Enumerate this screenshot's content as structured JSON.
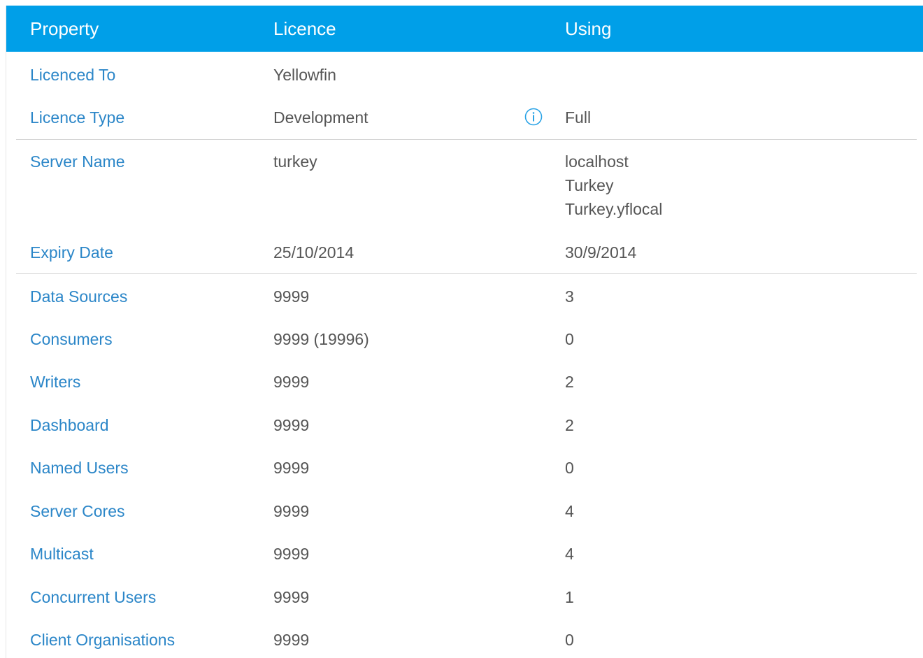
{
  "header": {
    "property": "Property",
    "licence": "Licence",
    "using": "Using"
  },
  "rows": [
    {
      "property": "Licenced To",
      "licence": "Yellowfin",
      "using": ""
    },
    {
      "property": "Licence Type",
      "licence": "Development",
      "using": "Full",
      "info_icon": "info-icon"
    },
    {
      "property": "Server Name",
      "licence": "turkey",
      "using": "localhost\nTurkey\nTurkey.yflocal"
    },
    {
      "property": "Expiry Date",
      "licence": "25/10/2014",
      "using": "30/9/2014"
    },
    {
      "property": "Data Sources",
      "licence": "9999",
      "using": "3"
    },
    {
      "property": "Consumers",
      "licence": "9999 (19996)",
      "using": "0"
    },
    {
      "property": "Writers",
      "licence": "9999",
      "using": "2"
    },
    {
      "property": "Dashboard",
      "licence": "9999",
      "using": "2"
    },
    {
      "property": "Named Users",
      "licence": "9999",
      "using": "0"
    },
    {
      "property": "Server Cores",
      "licence": "9999",
      "using": "4"
    },
    {
      "property": "Multicast",
      "licence": "9999",
      "using": "4"
    },
    {
      "property": "Concurrent Users",
      "licence": "9999",
      "using": "1"
    },
    {
      "property": "Client Organisations",
      "licence": "9999",
      "using": "0"
    }
  ],
  "colors": {
    "header_bg": "#009fe8",
    "property_text": "#2b86c8",
    "value_text": "#555555",
    "divider": "#d6d6d6"
  }
}
